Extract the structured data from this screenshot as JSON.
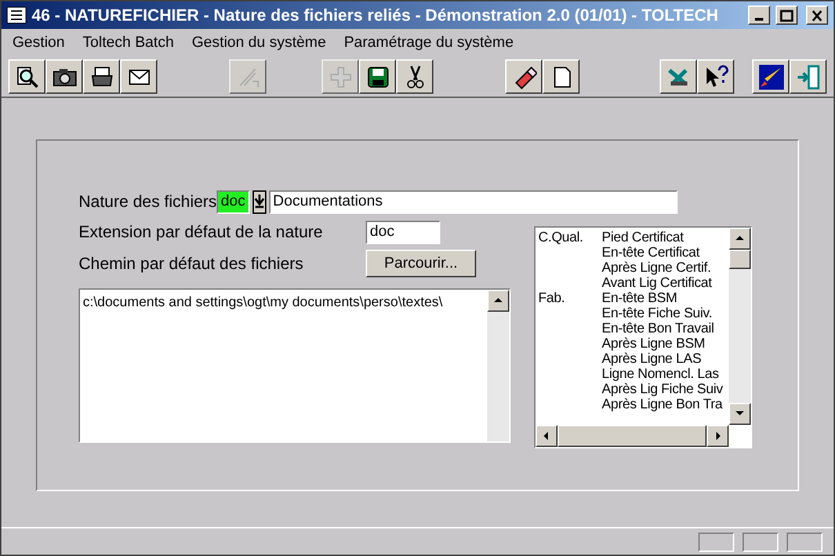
{
  "window": {
    "title": "46 - NATUREFICHIER - Nature des fichiers reliés - Démonstration 2.0 (01/01) - TOLTECH"
  },
  "menu": [
    "Gestion",
    "Toltech Batch",
    "Gestion du système",
    "Paramétrage du système"
  ],
  "toolbar": [
    [
      {
        "disabled": false
      },
      {
        "disabled": false
      },
      {
        "disabled": false
      },
      {
        "disabled": false
      }
    ],
    [
      {
        "disabled": true
      }
    ],
    [
      {
        "disabled": true
      },
      {
        "disabled": false
      },
      {
        "disabled": false
      }
    ],
    [
      {
        "disabled": false
      },
      {
        "disabled": false
      }
    ],
    [
      {
        "disabled": false
      },
      {
        "disabled": false
      }
    ],
    [
      {
        "disabled": false
      },
      {
        "disabled": false
      }
    ]
  ],
  "form": {
    "nature_label": "Nature des fichiers",
    "nature_code": "doc",
    "nature_name": "Documentations",
    "extension_label": "Extension par défaut de la nature",
    "extension_value": "doc",
    "path_label": "Chemin par défaut des fichiers",
    "browse_button": "Parcourir...",
    "path_value": "c:\\documents and settings\\ogt\\my documents\\perso\\textes\\"
  },
  "list": [
    {
      "category": "C.Qual.",
      "label": "Pied Certificat"
    },
    {
      "label": "En-tête Certificat"
    },
    {
      "label": "Après Ligne Certif."
    },
    {
      "label": "Avant Lig Certificat"
    },
    {
      "category": "Fab.",
      "label": "En-tête BSM"
    },
    {
      "label": "En-tête Fiche Suiv."
    },
    {
      "label": "En-tête Bon Travail"
    },
    {
      "label": "Après Ligne BSM"
    },
    {
      "label": "Après Ligne LAS"
    },
    {
      "label": "Ligne Nomencl. Las"
    },
    {
      "label": "Après Lig Fiche Suiv"
    },
    {
      "label": "Après Ligne Bon Tra"
    }
  ]
}
